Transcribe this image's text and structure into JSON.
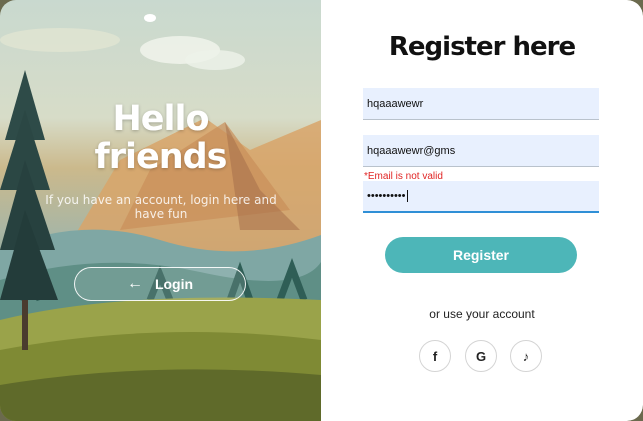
{
  "left_panel": {
    "heading_line1": "Hello",
    "heading_line2": "friends",
    "subtext": "If you have an account, login here and have fun",
    "login_button_label": "Login",
    "login_icon": "arrow-left-icon"
  },
  "form": {
    "title": "Register here",
    "username_value": "hqaaawewr",
    "email_value": "hqaaawewr@gms",
    "email_error": "*Email is not valid",
    "password_value": "••••••••••",
    "register_label": "Register",
    "alt_text": "or use your account"
  },
  "social": [
    {
      "name": "facebook-icon",
      "glyph": "f"
    },
    {
      "name": "google-icon",
      "glyph": "G"
    },
    {
      "name": "tiktok-icon",
      "glyph": "♪"
    }
  ],
  "colors": {
    "accent": "#4db6b8",
    "error": "#e02424",
    "field_bg": "#e8f0fe",
    "focus_border": "#2f8fd6"
  }
}
